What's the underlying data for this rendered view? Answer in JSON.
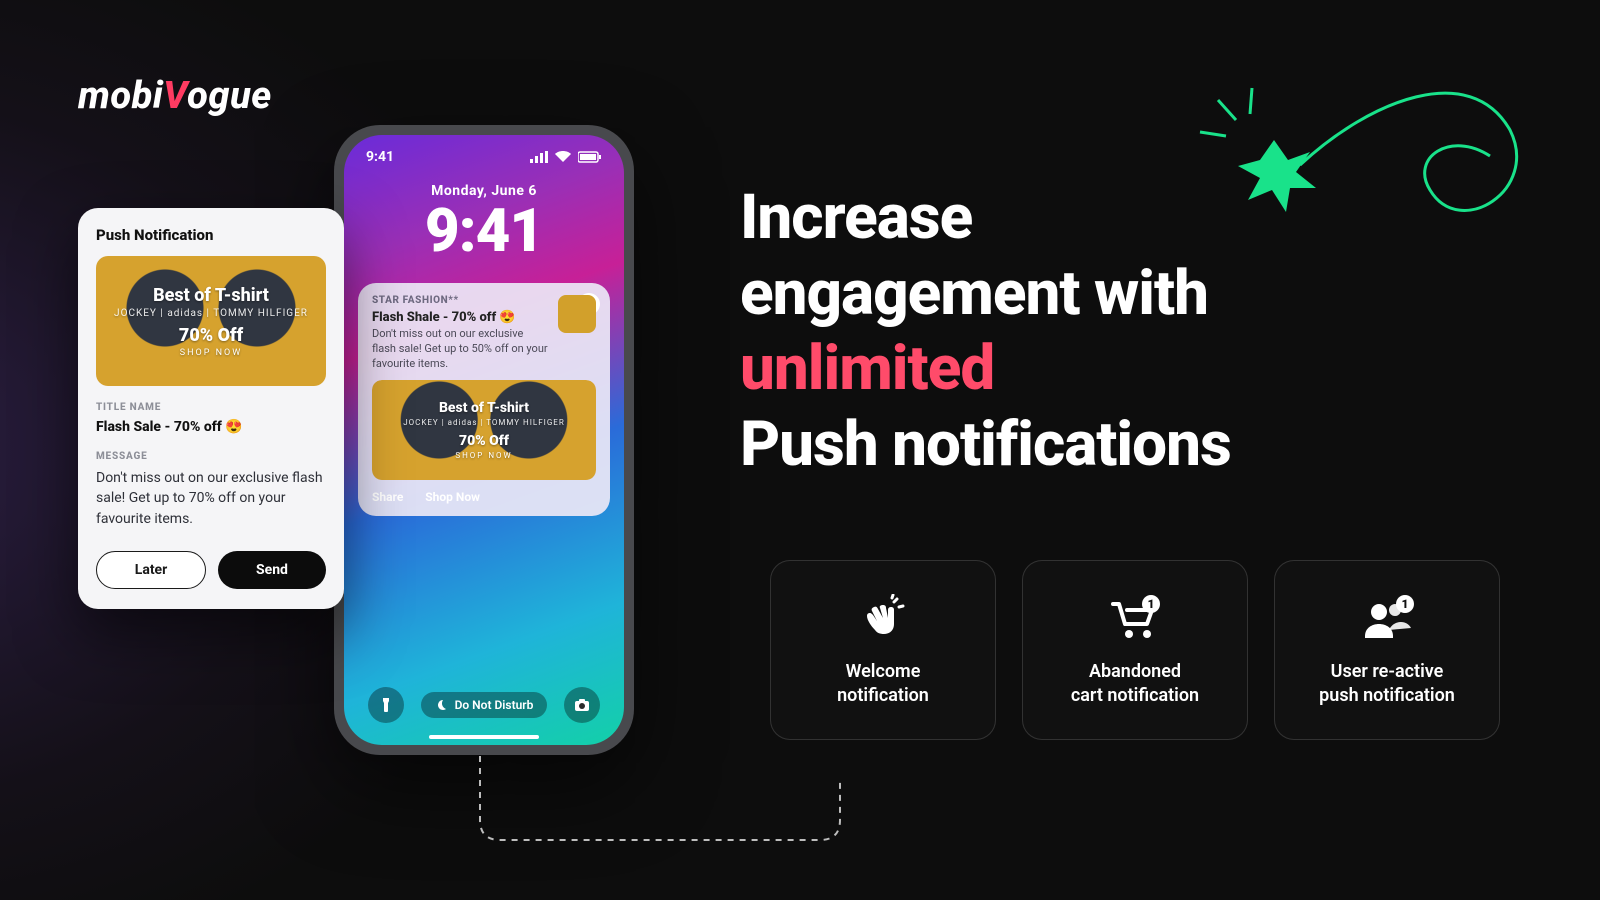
{
  "brand": {
    "pre": "mobi",
    "v": "V",
    "post": "ogue"
  },
  "headline": {
    "l1": "Increase",
    "l2": "engagement with",
    "l3_accent": "unlimited",
    "l4": "Push notifications"
  },
  "tiles": [
    {
      "icon": "wave-hand-icon",
      "line1": "Welcome",
      "line2": "notification"
    },
    {
      "icon": "cart-badge-icon",
      "line1": "Abandoned",
      "line2": "cart notification"
    },
    {
      "icon": "users-badge-icon",
      "line1": "User re-active",
      "line2": "push notification"
    }
  ],
  "phone": {
    "status_time": "9:41",
    "lock_date": "Monday, June 6",
    "lock_time": "9:41",
    "dnd": "Do Not Disturb",
    "notif": {
      "app": "STAR FASHION**",
      "title": "Flash Shale - 70% off 😍",
      "body": "Don't miss out on our exclusive flash sale! Get up to 50% off on your favourite items.",
      "action_share": "Share",
      "action_shop": "Shop Now"
    }
  },
  "promo": {
    "title": "Best of T-shirt",
    "brands": "JOCKEY  |  adidas  |  TOMMY HILFIGER",
    "discount": "70% Off",
    "cta": "SHOP NOW"
  },
  "composer": {
    "heading": "Push Notification",
    "title_label": "TITLE NAME",
    "title_value": "Flash Sale - 70% off 😍",
    "message_label": "MESSAGE",
    "message_value": "Don't miss out on our exclusive flash sale! Get up to 70% off on your favourite items.",
    "later": "Later",
    "send": "Send"
  }
}
